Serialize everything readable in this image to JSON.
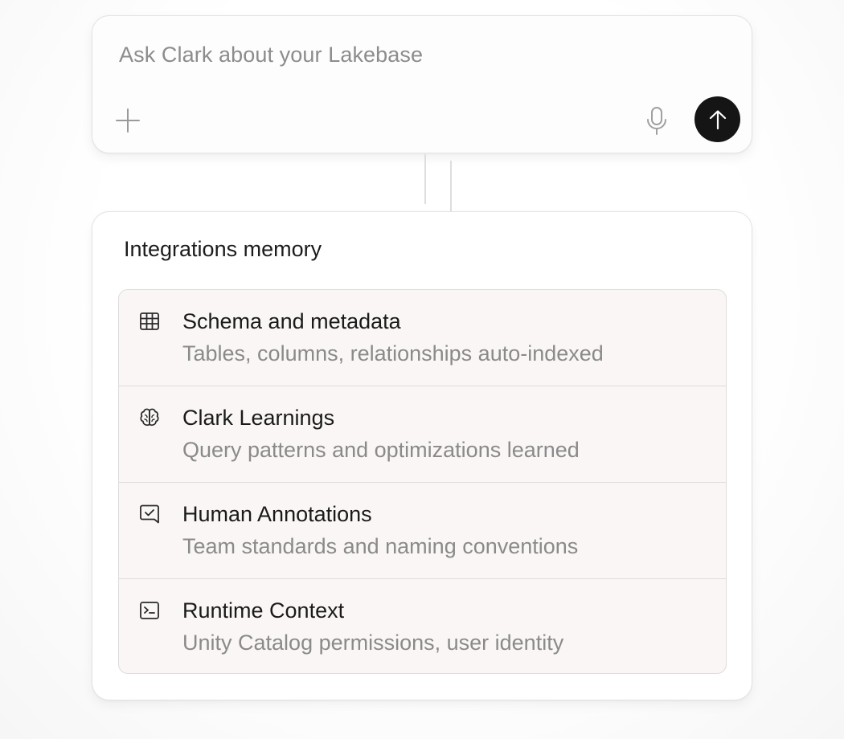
{
  "prompt": {
    "placeholder": "Ask Clark about your Lakebase",
    "icons": {
      "add": "plus-icon",
      "voice": "microphone-icon",
      "send": "arrow-up-icon"
    },
    "send_button_color": "#151515"
  },
  "memory": {
    "title": "Integrations memory",
    "items": [
      {
        "icon": "table-icon",
        "title": "Schema and metadata",
        "description": "Tables, columns, relationships auto-indexed"
      },
      {
        "icon": "brain-icon",
        "title": "Clark Learnings",
        "description": "Query patterns and optimizations learned"
      },
      {
        "icon": "message-check-icon",
        "title": "Human Annotations",
        "description": "Team standards and naming conventions"
      },
      {
        "icon": "terminal-icon",
        "title": "Runtime Context",
        "description": "Unity Catalog permissions, user identity"
      }
    ]
  }
}
